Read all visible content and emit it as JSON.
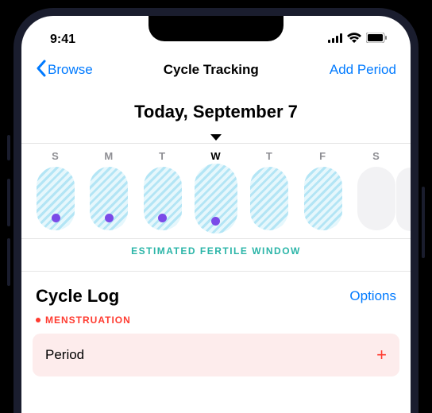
{
  "statusBar": {
    "time": "9:41"
  },
  "nav": {
    "back": "Browse",
    "title": "Cycle Tracking",
    "action": "Add Period"
  },
  "today": {
    "label": "Today, September 7"
  },
  "week": {
    "days": [
      {
        "letter": "S",
        "fertile": true,
        "dot": true,
        "today": false
      },
      {
        "letter": "M",
        "fertile": true,
        "dot": true,
        "today": false
      },
      {
        "letter": "T",
        "fertile": true,
        "dot": true,
        "today": false
      },
      {
        "letter": "W",
        "fertile": true,
        "dot": true,
        "today": true
      },
      {
        "letter": "T",
        "fertile": true,
        "dot": false,
        "today": false
      },
      {
        "letter": "F",
        "fertile": true,
        "dot": false,
        "today": false
      },
      {
        "letter": "S",
        "fertile": false,
        "dot": false,
        "today": false
      }
    ],
    "fertileLabel": "ESTIMATED FERTILE WINDOW"
  },
  "cycleLog": {
    "title": "Cycle Log",
    "options": "Options",
    "section": "MENSTRUATION",
    "periodRow": "Period"
  }
}
